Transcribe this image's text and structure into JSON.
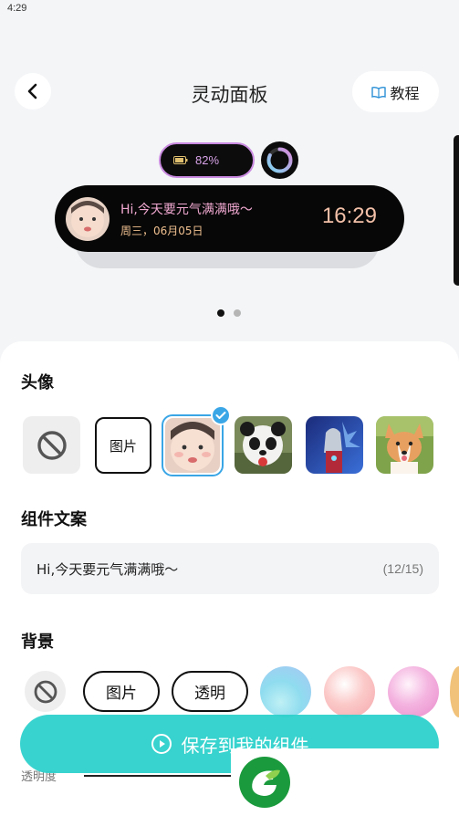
{
  "status_bar": {
    "time": "4:29"
  },
  "header": {
    "title": "灵动面板",
    "tutorial_label": "教程"
  },
  "preview": {
    "battery_percent_text": "82%",
    "ring_progress": 0.82,
    "island_message": "Hi,今天要元气满满哦～",
    "island_date": "周三，06月05日",
    "island_time": "16:29",
    "page_dots": 2,
    "active_dot": 0
  },
  "avatar_section": {
    "title": "头像",
    "image_button_label": "图片",
    "options": [
      "none",
      "image",
      "baby",
      "panda",
      "ultraman",
      "corgi"
    ],
    "selected": "baby"
  },
  "caption_section": {
    "title": "组件文案",
    "value": "Hi,今天要元气满满哦～",
    "counter": "(12/15)"
  },
  "background_section": {
    "title": "背景",
    "image_label": "图片",
    "transparent_label": "透明",
    "swatch_colors": [
      "#8fdcef",
      "#fbc9c8",
      "#f4b4e0",
      "#f1c27a"
    ]
  },
  "save_button_label": "保存到我的组件",
  "opacity_label": "透明度",
  "colors": {
    "accent": "#2ed1cc",
    "selected_border": "#3aa6e6",
    "island_bg": "#070707"
  }
}
